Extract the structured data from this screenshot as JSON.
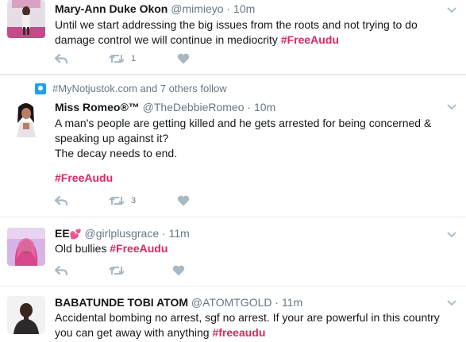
{
  "tweets": [
    {
      "name": "Mary-Ann Duke Okon",
      "handle": "@mimieyo",
      "time": "10m",
      "text": "Until we start addressing the big issues from the roots and not trying to do damage control we will continue in mediocrity",
      "hashtag": "#FreeAudu",
      "retweets": "1",
      "likes": ""
    },
    {
      "social_context": "#MyNotjustok.com and 7 others follow",
      "name": "Miss Romeo®™",
      "handle": "@TheDebbieRomeo",
      "time": "10m",
      "text": "A man's people are getting killed and he gets arrested for being concerned & speaking up against it?\nThe decay needs to end.",
      "hashtag": "#FreeAudu",
      "retweets": "3",
      "likes": ""
    },
    {
      "name": "EE",
      "name_emoji": "💕",
      "handle": "@girlplusgrace",
      "time": "11m",
      "text": "Old bullies",
      "hashtag": "#FreeAudu",
      "retweets": "",
      "likes": ""
    },
    {
      "name": "BABATUNDE TOBI ATOM",
      "handle": "@ATOMTGOLD",
      "time": "11m",
      "text": "Accidental bombing no arrest, sgf no arrest. If your are powerful in this country you can get away with anything",
      "hashtag": "#freeaudu"
    }
  ],
  "icons": {
    "reply": "reply-icon",
    "retweet": "retweet-icon",
    "like": "heart-icon",
    "more": "chevron-down-icon",
    "follow": "person-icon"
  },
  "colors": {
    "hashtag": "#e0245e",
    "handle": "#657786",
    "icon": "#aab8c2"
  }
}
